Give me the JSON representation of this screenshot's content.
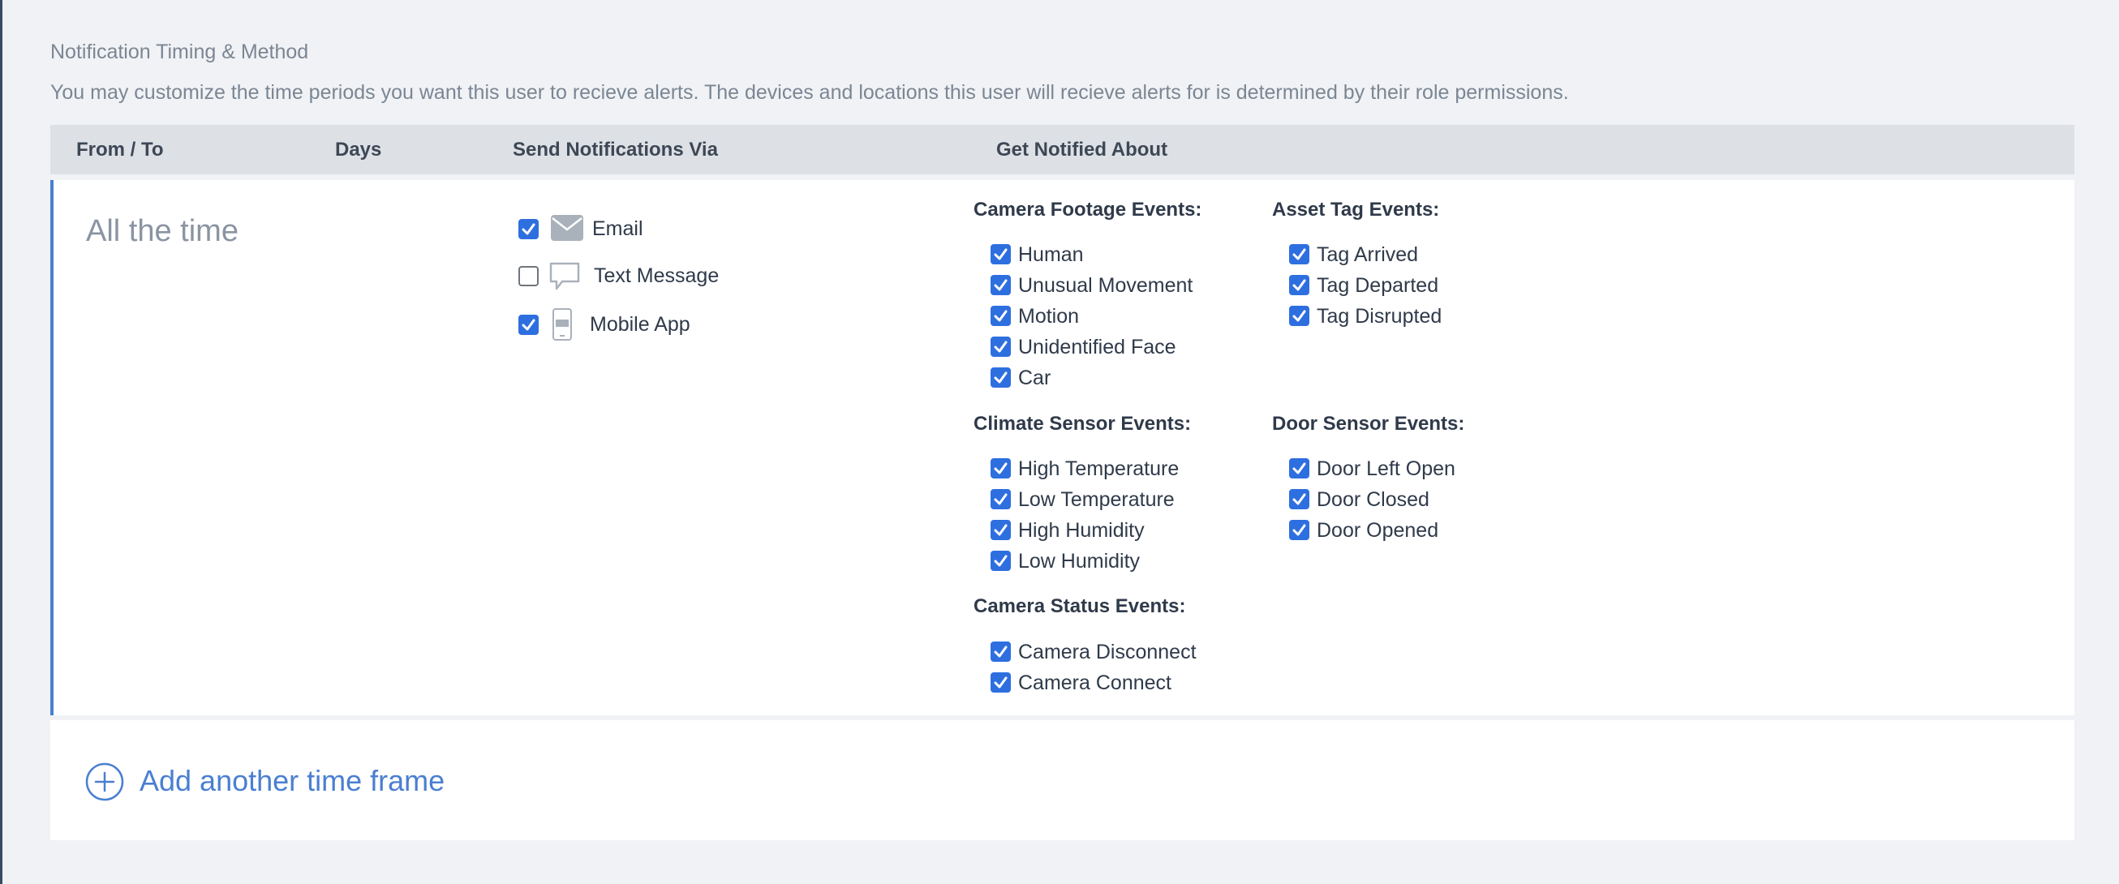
{
  "section": {
    "title": "Notification Timing & Method",
    "description": "You may customize the time periods you want this user to recieve alerts. The devices and locations this user will recieve alerts for is determined by their role permissions."
  },
  "table": {
    "headers": {
      "from_to": "From / To",
      "days": "Days",
      "send_via": "Send Notifications Via",
      "notified_about": "Get Notified About"
    }
  },
  "row": {
    "time_label": "All the time",
    "methods": [
      {
        "label": "Email",
        "checked": true,
        "icon": "envelope-icon"
      },
      {
        "label": "Text Message",
        "checked": false,
        "icon": "chat-bubble-icon"
      },
      {
        "label": "Mobile App",
        "checked": true,
        "icon": "mobile-phone-icon"
      }
    ],
    "groups": {
      "camera_footage": {
        "title": "Camera Footage Events:",
        "events": [
          {
            "label": "Human",
            "checked": true
          },
          {
            "label": "Unusual Movement",
            "checked": true
          },
          {
            "label": "Motion",
            "checked": true
          },
          {
            "label": "Unidentified Face",
            "checked": true
          },
          {
            "label": "Car",
            "checked": true
          }
        ]
      },
      "asset_tag": {
        "title": "Asset Tag Events:",
        "events": [
          {
            "label": "Tag Arrived",
            "checked": true
          },
          {
            "label": "Tag Departed",
            "checked": true
          },
          {
            "label": "Tag Disrupted",
            "checked": true
          }
        ]
      },
      "climate_sensor": {
        "title": "Climate Sensor Events:",
        "events": [
          {
            "label": "High Temperature",
            "checked": true
          },
          {
            "label": "Low Temperature",
            "checked": true
          },
          {
            "label": "High Humidity",
            "checked": true
          },
          {
            "label": "Low Humidity",
            "checked": true
          }
        ]
      },
      "door_sensor": {
        "title": "Door Sensor Events:",
        "events": [
          {
            "label": "Door Left Open",
            "checked": true
          },
          {
            "label": "Door Closed",
            "checked": true
          },
          {
            "label": "Door Opened",
            "checked": true
          }
        ]
      },
      "camera_status": {
        "title": "Camera Status Events:",
        "events": [
          {
            "label": "Camera Disconnect",
            "checked": true
          },
          {
            "label": "Camera Connect",
            "checked": true
          }
        ]
      }
    }
  },
  "add_timeframe": {
    "label": "Add another time frame",
    "icon": "plus-circle-icon"
  },
  "colors": {
    "accent": "#4a7fd1",
    "checkbox": "#2e6fe0",
    "header_bg": "#dde1e6",
    "page_bg": "#f0f2f5"
  }
}
